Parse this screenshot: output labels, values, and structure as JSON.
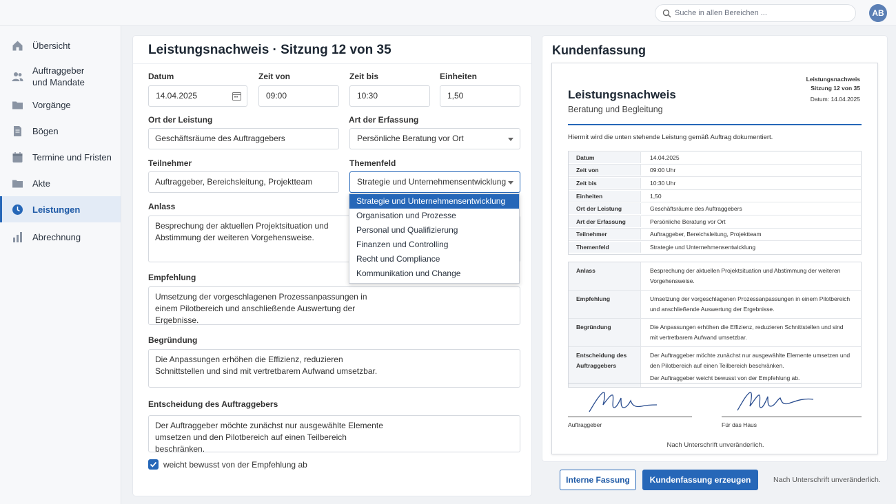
{
  "topbar": {
    "search_placeholder": "Suche in allen Bereichen ...",
    "avatar_initials": "AB"
  },
  "sidebar": {
    "items": [
      {
        "label": "Übersicht",
        "icon": "home-icon"
      },
      {
        "label": "Auftraggeber\nund Mandate",
        "icon": "users-icon"
      },
      {
        "label": "Vorgänge",
        "icon": "folder-icon"
      },
      {
        "label": "Bögen",
        "icon": "document-icon"
      },
      {
        "label": "Termine und Fristen",
        "icon": "calendar-icon"
      },
      {
        "label": "Akte",
        "icon": "folder-icon"
      },
      {
        "label": "Leistungen",
        "icon": "clock-icon",
        "active": true
      },
      {
        "label": "Abrechnung",
        "icon": "bar-chart-icon"
      }
    ]
  },
  "form": {
    "title": "Leistungsnachweis · Sitzung 12 von 35",
    "datum": {
      "label": "Datum",
      "value": "14.04.2025"
    },
    "zeit_von": {
      "label": "Zeit von",
      "value": "09:00"
    },
    "zeit_bis": {
      "label": "Zeit bis",
      "value": "10:30"
    },
    "einheiten": {
      "label": "Einheiten",
      "value": "1,50"
    },
    "ort": {
      "label": "Ort der Leistung",
      "value": "Geschäftsräume des Auftraggebers"
    },
    "art": {
      "label": "Art der Erfassung",
      "value": "Persönliche Beratung vor Ort"
    },
    "teilnehmer": {
      "label": "Teilnehmer",
      "value": "Auftraggeber, Bereichsleitung, Projektteam"
    },
    "themenfeld": {
      "label": "Themenfeld",
      "value": "Strategie und Unternehmensentwicklung",
      "options": [
        "Strategie und Unternehmensentwicklung",
        "Organisation und Prozesse",
        "Personal und Qualifizierung",
        "Finanzen und Controlling",
        "Recht und Compliance",
        "Kommunikation und Change"
      ]
    },
    "anlass": {
      "label": "Anlass",
      "value": "Besprechung der aktuellen Projektsituation und Abstimmung der weiteren Vorgehensweise."
    },
    "empfehlung": {
      "label": "Empfehlung",
      "value": "Umsetzung der vorgeschlagenen Prozessanpassungen in einem Pilotbereich und anschließende Auswertung der Ergebnisse."
    },
    "begruendung": {
      "label": "Begründung",
      "value": "Die Anpassungen erhöhen die Effizienz, reduzieren Schnittstellen und sind mit vertretbarem Aufwand umsetzbar."
    },
    "entscheidung": {
      "label": "Entscheidung des Auftraggebers",
      "value": "Der Auftraggeber möchte zunächst nur ausgewählte Elemente umsetzen und den Pilotbereich auf einen Teilbereich beschränken."
    },
    "checkbox": {
      "label": "weicht bewusst von der Empfehlung ab",
      "checked": true
    }
  },
  "summary": {
    "title": "Kundenfassung",
    "doc": {
      "meta_title": "Leistungsnachweis",
      "meta_session": "Sitzung 12 von 35",
      "meta_date": "Datum: 14.04.2025",
      "title": "Leistungsnachweis",
      "subtitle": "Beratung und Begleitung",
      "intro": "Hiermit wird die unten stehende Leistung gemäß Auftrag dokumentiert.",
      "table1": [
        {
          "k": "Datum",
          "v": "14.04.2025"
        },
        {
          "k": "Zeit von",
          "v": "09:00 Uhr"
        },
        {
          "k": "Zeit bis",
          "v": "10:30 Uhr"
        },
        {
          "k": "Einheiten",
          "v": "1,50"
        },
        {
          "k": "Ort der Leistung",
          "v": "Geschäftsräume des Auftraggebers"
        },
        {
          "k": "Art der Erfassung",
          "v": "Persönliche Beratung vor Ort"
        },
        {
          "k": "Teilnehmer",
          "v": "Auftraggeber, Bereichsleitung, Projektteam"
        },
        {
          "k": "Themenfeld",
          "v": "Strategie und Unternehmensentwicklung"
        }
      ],
      "table2": [
        {
          "k": "Anlass",
          "v": "Besprechung der aktuellen Projektsituation und Abstimmung der weiteren Vorgehensweise."
        },
        {
          "k": "Empfehlung",
          "v": "Umsetzung der vorgeschlagenen Prozessanpassungen in einem Pilotbereich und anschließende Auswertung der Ergebnisse."
        },
        {
          "k": "Begründung",
          "v": "Die Anpassungen erhöhen die Effizienz, reduzieren Schnittstellen und sind mit vertretbarem Aufwand umsetzbar."
        },
        {
          "k": "Entscheidung des Auftraggebers",
          "v": "Der Auftraggeber möchte zunächst nur ausgewählte Elemente umsetzen und den Pilotbereich auf einen Teilbereich beschränken.",
          "v2": "Der Auftraggeber weicht bewusst von der Empfehlung ab."
        }
      ],
      "sig_left": "Auftraggeber",
      "sig_right": "Für das Haus",
      "footer": "Nach Unterschrift unveränderlich."
    },
    "btn_internal": "Interne Fassung",
    "btn_generate": "Kundenfassung erzeugen",
    "note": "Nach Unterschrift unveränderlich."
  },
  "colors": {
    "accent": "#2667b8",
    "background": "#f0f2f5"
  }
}
